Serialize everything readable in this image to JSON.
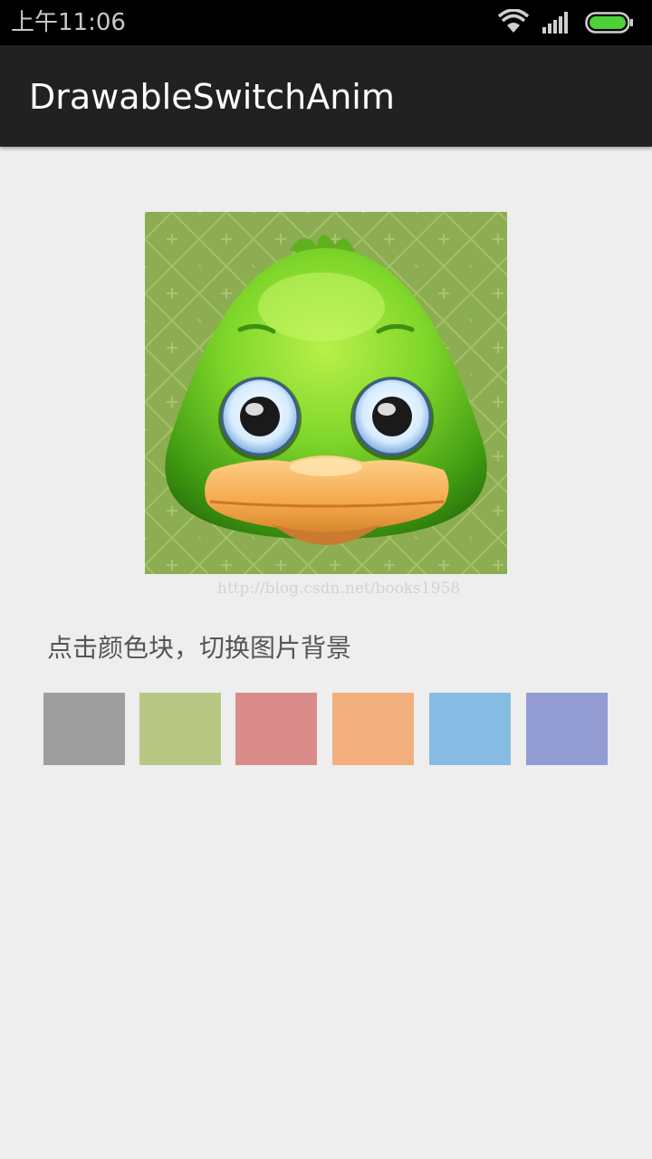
{
  "status_bar": {
    "time": "上午11:06",
    "icons": [
      "wifi-icon",
      "signal-icon",
      "battery-icon"
    ],
    "battery_color": "#4cd137"
  },
  "action_bar": {
    "title": "DrawableSwitchAnim",
    "background": "#212121"
  },
  "content": {
    "image_name": "duck-icon",
    "image_background": "#8cad52",
    "watermark": "http://blog.csdn.net/books1958",
    "hint": "点击颜色块，切换图片背景",
    "swatches": [
      {
        "name": "gray",
        "color": "#9e9e9e"
      },
      {
        "name": "green",
        "color": "#b9c785"
      },
      {
        "name": "red",
        "color": "#d98b8a"
      },
      {
        "name": "orange",
        "color": "#f2ae7c"
      },
      {
        "name": "blue",
        "color": "#86bce4"
      },
      {
        "name": "purple",
        "color": "#929bd2"
      }
    ]
  }
}
